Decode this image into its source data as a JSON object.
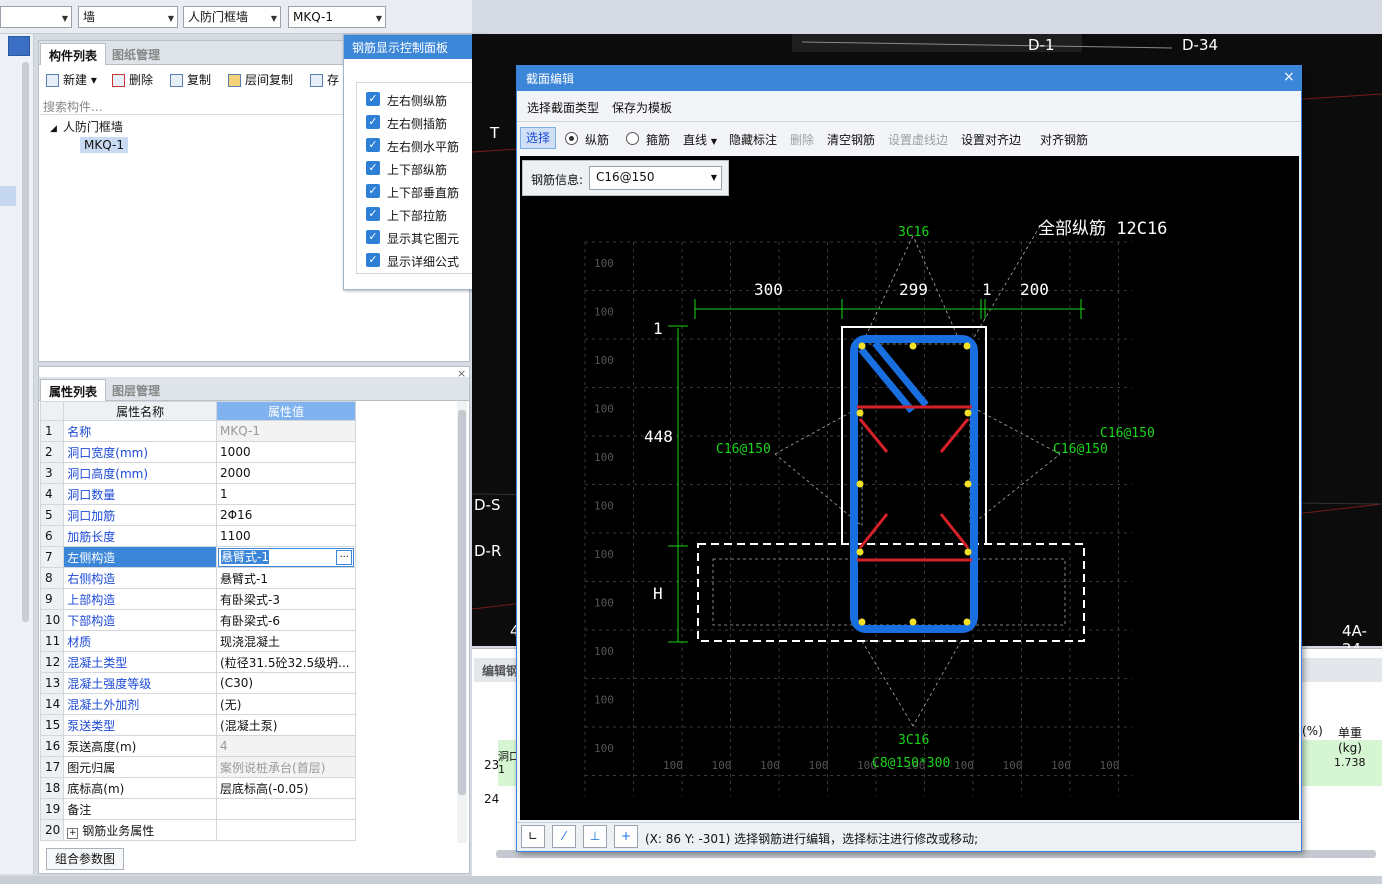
{
  "top_selectors": [
    "",
    "墙",
    "人防门框墙",
    "MKQ-1"
  ],
  "left_panel": {
    "tabs": [
      "构件列表",
      "图纸管理"
    ],
    "toolbar": [
      "新建",
      "删除",
      "复制",
      "层间复制",
      "存"
    ],
    "search_placeholder": "搜索构件...",
    "tree": {
      "root": "人防门框墙",
      "child": "MKQ-1"
    }
  },
  "props_panel": {
    "tabs": [
      "属性列表",
      "图层管理"
    ],
    "headers": [
      "属性名称",
      "属性值"
    ],
    "rows": [
      {
        "n": "1",
        "k": "名称",
        "v": "MKQ-1",
        "grey": true
      },
      {
        "n": "2",
        "k": "洞口宽度(mm)",
        "v": "1000"
      },
      {
        "n": "3",
        "k": "洞口高度(mm)",
        "v": "2000"
      },
      {
        "n": "4",
        "k": "洞口数量",
        "v": "1"
      },
      {
        "n": "5",
        "k": "洞口加筋",
        "v": "2Φ16"
      },
      {
        "n": "6",
        "k": "加筋长度",
        "v": "1100"
      },
      {
        "n": "7",
        "k": "左侧构造",
        "v": "悬臂式-1",
        "selected": true
      },
      {
        "n": "8",
        "k": "右侧构造",
        "v": "悬臂式-1"
      },
      {
        "n": "9",
        "k": "上部构造",
        "v": "有卧梁式-3"
      },
      {
        "n": "10",
        "k": "下部构造",
        "v": "有卧梁式-6"
      },
      {
        "n": "11",
        "k": "材质",
        "v": "现浇混凝土"
      },
      {
        "n": "12",
        "k": "混凝土类型",
        "v": "(粒径31.5砼32.5级坍..."
      },
      {
        "n": "13",
        "k": "混凝土强度等级",
        "v": "(C30)"
      },
      {
        "n": "14",
        "k": "混凝土外加剂",
        "v": "(无)"
      },
      {
        "n": "15",
        "k": "泵送类型",
        "v": "(混凝土泵)"
      },
      {
        "n": "16",
        "k": "泵送高度(m)",
        "v": "4",
        "grey": true,
        "black": true
      },
      {
        "n": "17",
        "k": "图元归属",
        "v": "案例说桩承台(首层)",
        "grey": true,
        "black": true
      },
      {
        "n": "18",
        "k": "底标高(m)",
        "v": "层底标高(-0.05)",
        "black": true
      },
      {
        "n": "19",
        "k": "备注",
        "v": "",
        "black": true
      },
      {
        "n": "20",
        "k": "钢筋业务属性",
        "v": "",
        "black": true,
        "expand": true
      }
    ],
    "footer_button": "组合参数图"
  },
  "rebar_control_panel": {
    "title": "钢筋显示控制面板",
    "items": [
      "左右侧纵筋",
      "左右侧插筋",
      "左右侧水平筋",
      "上下部纵筋",
      "上下部垂直筋",
      "上下部拉筋",
      "显示其它图元",
      "显示详细公式"
    ]
  },
  "cad_labels": {
    "d34": "D-34",
    "d1": "D-1",
    "t": "T",
    "ds": "D-S",
    "dr": "D-R",
    "a4": "4A-24",
    "n4": "4"
  },
  "bottom_panel": {
    "tab": "编辑钢",
    "rows": [
      "23",
      "24"
    ],
    "cell_label": "洞口1",
    "col_pct": "(%)",
    "col_unit": "单重(kg)",
    "unit_weight": "1.738"
  },
  "section_dialog": {
    "title": "截面编辑",
    "menu": [
      "选择截面类型",
      "保存为模板"
    ],
    "toolbar": {
      "select": "选择",
      "radio_long": "纵筋",
      "radio_stir": "箍筋",
      "line": "直线",
      "hide_dim": "隐藏标注",
      "delete": "删除",
      "clear": "清空钢筋",
      "set_virtual": "设置虚线边",
      "set_align": "设置对齐边",
      "align": "对齐钢筋"
    },
    "rebar_info_label": "钢筋信息:",
    "rebar_info_value": "C16@150",
    "canvas": {
      "total": "全部纵筋 12C16",
      "top_bar": "3C16",
      "bottom_bar": "3C16",
      "stirrup": "C8@150*300",
      "left_dist": "C16@150",
      "right_dist_a": "C16@150",
      "right_dist_b": "C16@150",
      "dim_top": [
        "300",
        "299",
        "1",
        "200"
      ],
      "dim_left_1": "1",
      "dim_left_448": "448",
      "dim_left_h": "H",
      "grid_label": "100"
    },
    "status": "(X: 86 Y: -301) 选择钢筋进行编辑，选择标注进行修改或移动;"
  }
}
